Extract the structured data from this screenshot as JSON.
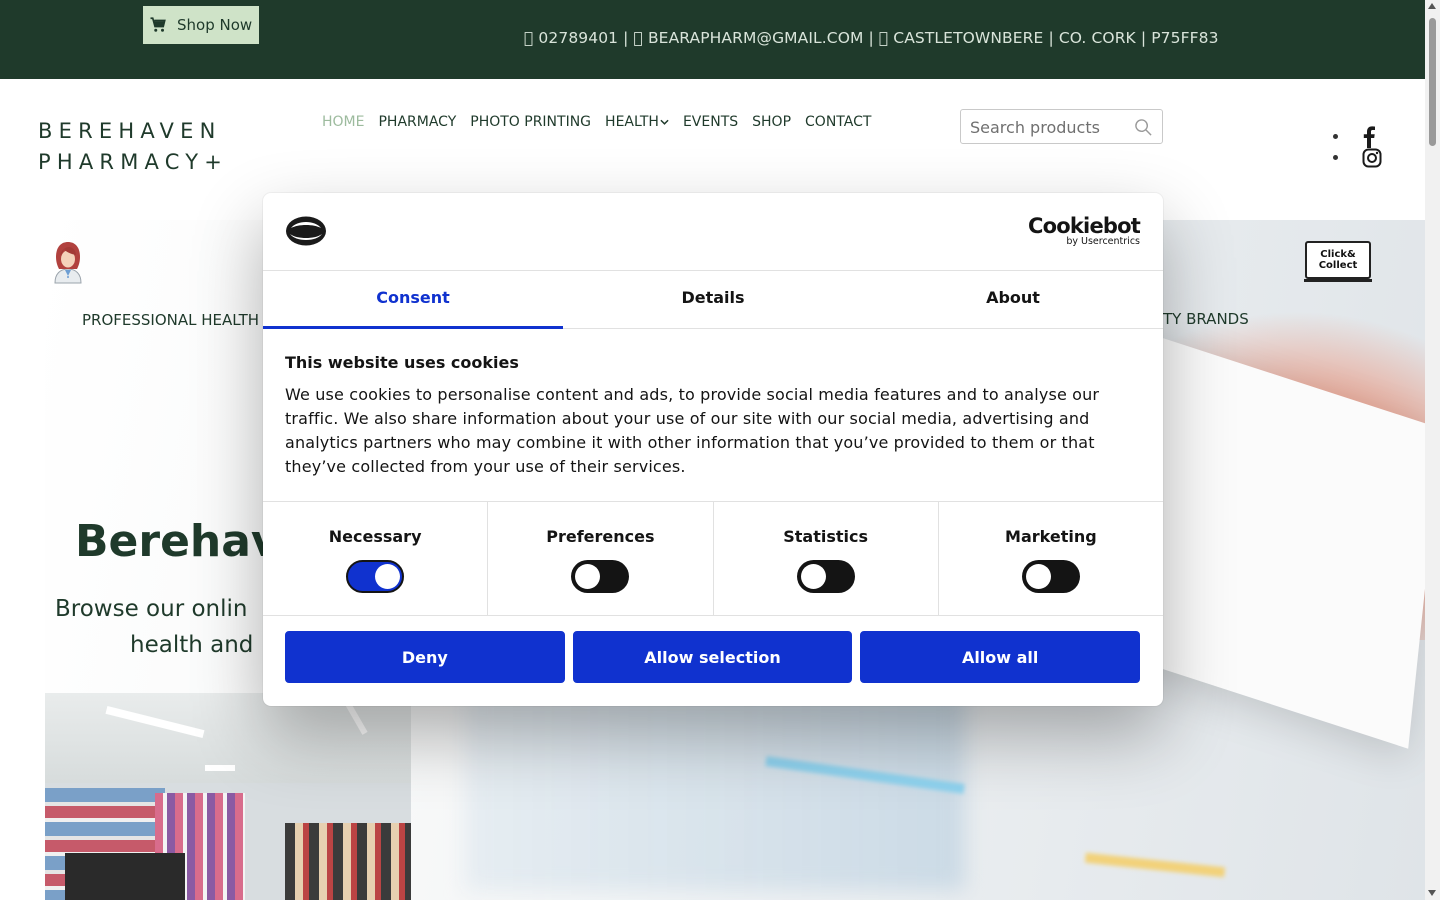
{
  "topbar": {
    "shop_now_label": "Shop Now",
    "phone": " 02789401 |",
    "email": " BEARAPHARM@GMAIL.COM |",
    "address": " CASTLETOWNBERE | CO. CORK | P75FF83",
    "icons": [
      "cart-icon",
      "phone-icon",
      "mail-icon",
      "map-marker-icon"
    ],
    "background_color": "#1f3a2b"
  },
  "header": {
    "logo_line1": "BEREHAVEN",
    "logo_line2": "PHARMACY+",
    "nav": [
      {
        "label": "HOME",
        "active": true
      },
      {
        "label": "PHARMACY"
      },
      {
        "label": "PHOTO PRINTING"
      },
      {
        "label": "HEALTH"
      },
      {
        "label": "EVENTS"
      },
      {
        "label": "SHOP"
      },
      {
        "label": "CONTACT"
      }
    ],
    "health_chevron": "⌵",
    "search_placeholder": "Search products",
    "social": [
      "facebook-icon",
      "instagram-icon"
    ]
  },
  "hero": {
    "feature_left": "PROFESSIONAL HEALTH",
    "feature_right": "UTY BRANDS",
    "click_collect": "Click& Collect",
    "title": "Berehav",
    "subtitle_line1": "Browse our onlin",
    "subtitle_line2": "health and"
  },
  "cookie_dialog": {
    "brand_name": "Cookiebot",
    "brand_sub": "by Usercentrics",
    "tabs": [
      {
        "label": "Consent",
        "active": true
      },
      {
        "label": "Details"
      },
      {
        "label": "About"
      }
    ],
    "title": "This website uses cookies",
    "body": "We use cookies to personalise content and ads, to provide social media features and to analyse our traffic. We also share information about your use of our site with our social media, advertising and analytics partners who may combine it with other information that you’ve provided to them or that they’ve collected from your use of their services.",
    "toggles": [
      {
        "label": "Necessary",
        "on": true
      },
      {
        "label": "Preferences",
        "on": false
      },
      {
        "label": "Statistics",
        "on": false
      },
      {
        "label": "Marketing",
        "on": false
      }
    ],
    "buttons": {
      "deny": "Deny",
      "allow_selection": "Allow selection",
      "allow_all": "Allow all"
    },
    "accent_color": "#1032cf"
  }
}
